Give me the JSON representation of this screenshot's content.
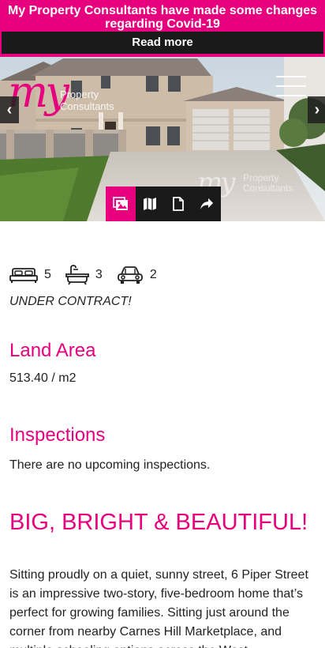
{
  "banner": {
    "message": "My Property Consultants have made some changes regarding Covid-19",
    "read_more_label": "Read more",
    "color": "#e6007e"
  },
  "logo": {
    "mark": "my",
    "line1": "Property",
    "line2": "Consultants"
  },
  "watermark": {
    "mark": "my",
    "line1": "Property",
    "line2": "Consultants"
  },
  "gallery": {
    "prev_icon": "chevron-left-icon",
    "next_icon": "chevron-right-icon",
    "prev_glyph": "‹",
    "next_glyph": "›",
    "tabs": [
      {
        "icon": "photos-icon",
        "active": true
      },
      {
        "icon": "map-icon",
        "active": false
      },
      {
        "icon": "floorplan-icon",
        "active": false
      },
      {
        "icon": "share-icon",
        "active": false
      }
    ]
  },
  "features": {
    "bedrooms": "5",
    "bathrooms": "3",
    "car_spaces": "2",
    "icons": [
      "bed-icon",
      "bath-icon",
      "car-icon"
    ]
  },
  "status": "UNDER CONTRACT!",
  "land_area": {
    "heading": "Land Area",
    "value": "513.40 / m2"
  },
  "inspections": {
    "heading": "Inspections",
    "text": "There are no upcoming inspections."
  },
  "listing": {
    "headline": "BIG, BRIGHT & BEAUTIFUL!",
    "description": "Sitting proudly on a quiet, sunny street, 6 Piper Street is an impressive two-story, five-bedroom home that’s perfect for growing families. Sitting just around the corner from nearby Carnes Hill Marketplace, and multiple schooling options across the West"
  },
  "colors": {
    "accent": "#e6007e",
    "dark": "#1a1a1a"
  }
}
